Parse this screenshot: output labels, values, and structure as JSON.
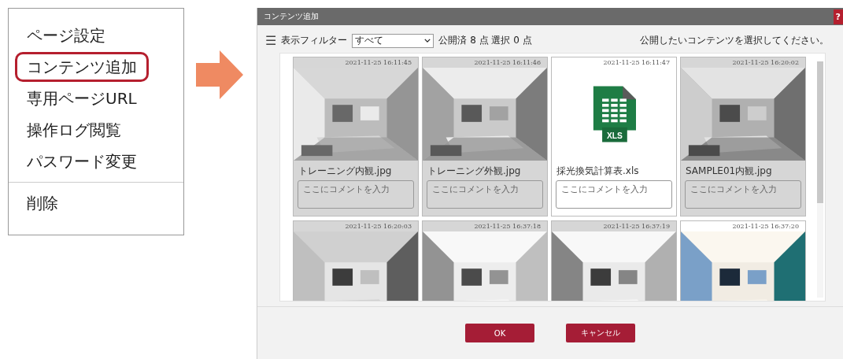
{
  "menu": {
    "items": [
      {
        "label": "ページ設定",
        "highlighted": false
      },
      {
        "label": "コンテンツ追加",
        "highlighted": true
      },
      {
        "label": "専用ページURL",
        "highlighted": false
      },
      {
        "label": "操作ログ閲覧",
        "highlighted": false
      },
      {
        "label": "パスワード変更",
        "highlighted": false
      }
    ],
    "danger_items": [
      {
        "label": "削除",
        "highlighted": false
      }
    ]
  },
  "dialog": {
    "title": "コンテンツ追加",
    "help": "?",
    "toolbar": {
      "menu_glyph": "☰",
      "filter_label": "表示フィルター",
      "filter_value": "すべて",
      "counts": "公開済 8 点 選択 0 点",
      "hint": "公開したいコンテンツを選択してください。"
    },
    "cards": [
      {
        "timestamp": "2021-11-25 16:11:45",
        "name": "トレーニング内観.jpg",
        "placeholder": "ここにコメントを入力",
        "disabled": true
      },
      {
        "timestamp": "2021-11-25 16:11:46",
        "name": "トレーニング外観.jpg",
        "placeholder": "ここにコメントを入力",
        "disabled": true
      },
      {
        "kind": "file",
        "timestamp": "2021-11-25 16:11:47",
        "name": "採光換気計算表.xls",
        "placeholder": "ここにコメントを入力",
        "file_label": "XLS",
        "disabled": false
      },
      {
        "timestamp": "2021-11-25 16:20:02",
        "name": "SAMPLE01内観.jpg",
        "placeholder": "ここにコメントを入力",
        "disabled": true
      },
      {
        "timestamp": "2021-11-25 16:20:03",
        "disabled": true
      },
      {
        "timestamp": "2021-11-25 16:37:18",
        "disabled": true
      },
      {
        "timestamp": "2021-11-25 16:37:19",
        "disabled": true
      },
      {
        "timestamp": "2021-11-25 16:37:20",
        "disabled": false
      }
    ],
    "buttons": [
      "OK",
      "キャンセル"
    ]
  }
}
